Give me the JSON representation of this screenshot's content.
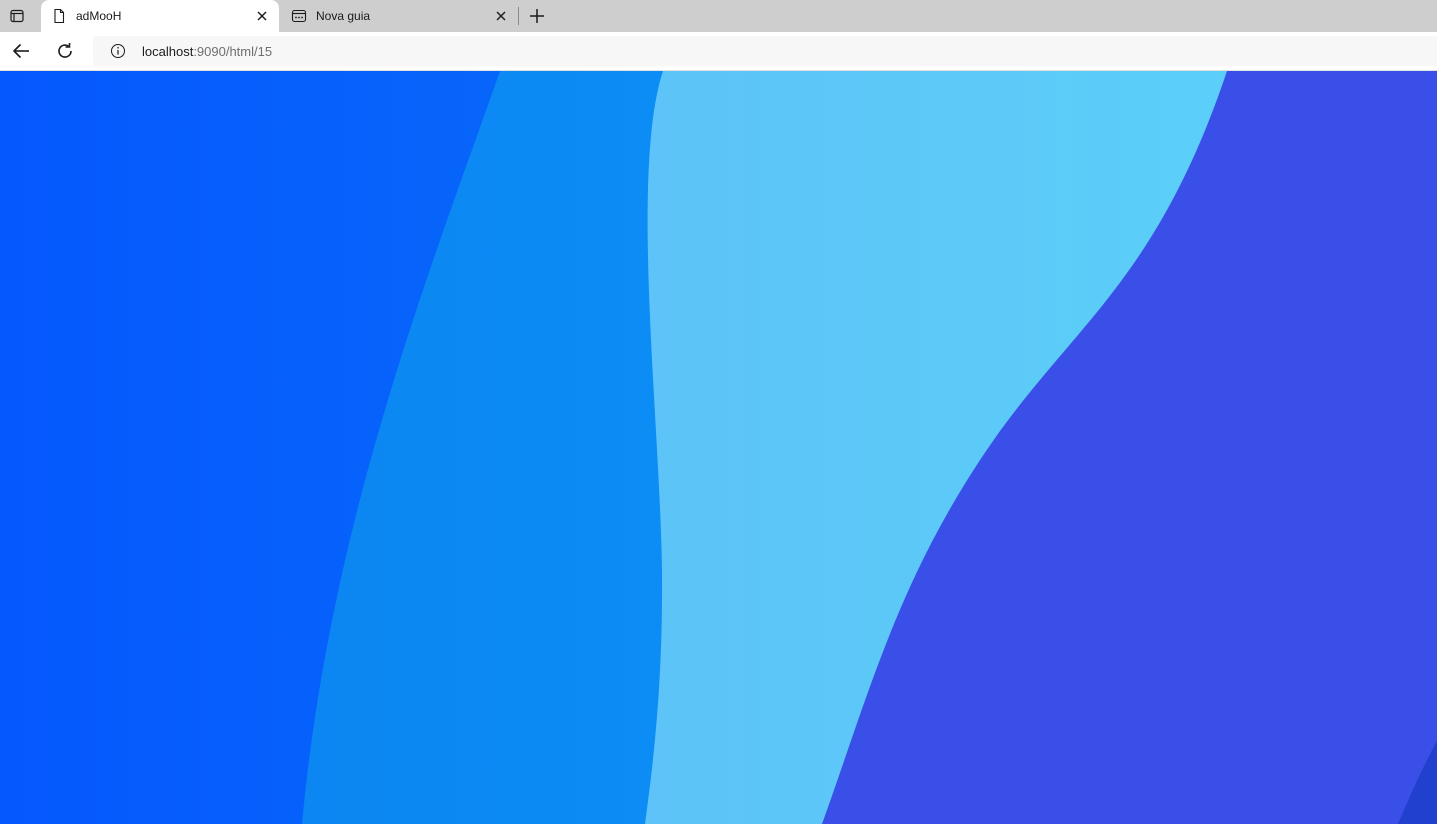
{
  "tabs": [
    {
      "title": "adMooH",
      "icon": "page-icon",
      "active": true
    },
    {
      "title": "Nova guia",
      "icon": "newtab-page-icon",
      "active": false
    }
  ],
  "address_bar": {
    "host": "localhost",
    "path": ":9090/html/15",
    "icon": "info-icon"
  },
  "page": {
    "background_colors": [
      "#0558fe",
      "#0c8ff6",
      "#5dc6f8",
      "#3a4fe7",
      "#2140cd"
    ]
  }
}
